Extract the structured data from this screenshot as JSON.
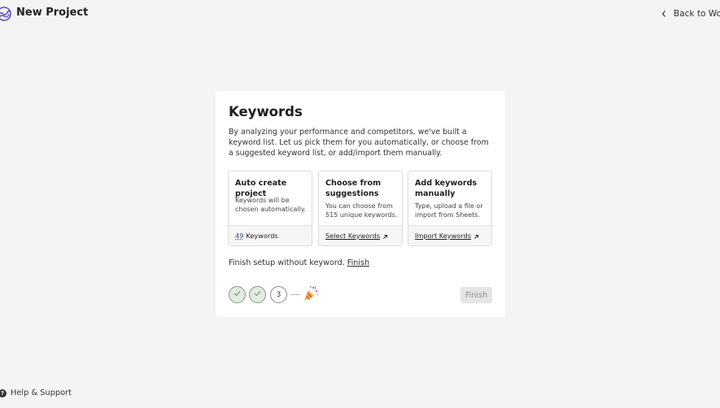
{
  "header": {
    "project_title": "New Project",
    "back_label": "Back to Wope"
  },
  "card": {
    "title": "Keywords",
    "description": "By analyzing your performance and competitors, we've built a keyword list. Let us pick them for you automatically, or choose from a suggested keyword list, or add/import them manually.",
    "options": [
      {
        "title": "Auto create project",
        "description": "Keywords will be chosen automatically.",
        "footer_count": "49",
        "footer_label": "Keywords"
      },
      {
        "title": "Choose from suggestions",
        "description": "You can choose from 515 unique keywords.",
        "footer_label": "Select Keywords"
      },
      {
        "title": "Add keywords manually",
        "description": "Type, upload a file or import from Sheets.",
        "footer_label": "Import Keywords"
      }
    ],
    "skip_text": "Finish setup without keyword.",
    "skip_link": "Finish",
    "steps": {
      "step3_label": "3",
      "party_icon": "party-popper-icon"
    },
    "finish_button": "Finish"
  },
  "footer": {
    "help_label": "Help & Support"
  },
  "colors": {
    "background": "#f4f4f4",
    "card": "#ffffff",
    "step_done": "#e3ebe3",
    "finish_disabled": "#e5e5e5",
    "logo_accent": "#5a4fd1"
  }
}
